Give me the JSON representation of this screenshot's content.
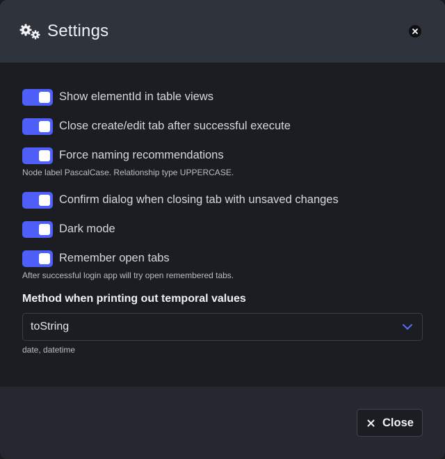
{
  "header": {
    "title": "Settings",
    "icon": "gears-icon"
  },
  "settings": [
    {
      "label": "Show elementId in table views",
      "enabled": true
    },
    {
      "label": "Close create/edit tab after successful execute",
      "enabled": true
    },
    {
      "label": "Force naming recommendations",
      "enabled": true,
      "hint": "Node label PascalCase. Relationship type UPPERCASE."
    },
    {
      "label": "Confirm dialog when closing tab with unsaved changes",
      "enabled": true
    },
    {
      "label": "Dark mode",
      "enabled": true
    },
    {
      "label": "Remember open tabs",
      "enabled": true,
      "hint": "After successful login app will try open remembered tabs."
    }
  ],
  "temporal": {
    "label": "Method when printing out temporal values",
    "selected": "toString",
    "hint": "date, datetime"
  },
  "footer": {
    "close_label": "Close"
  },
  "colors": {
    "accent": "#4f5ffa",
    "header_bg": "#2e333c",
    "body_bg": "#1b1d22",
    "footer_bg": "#25282f"
  }
}
